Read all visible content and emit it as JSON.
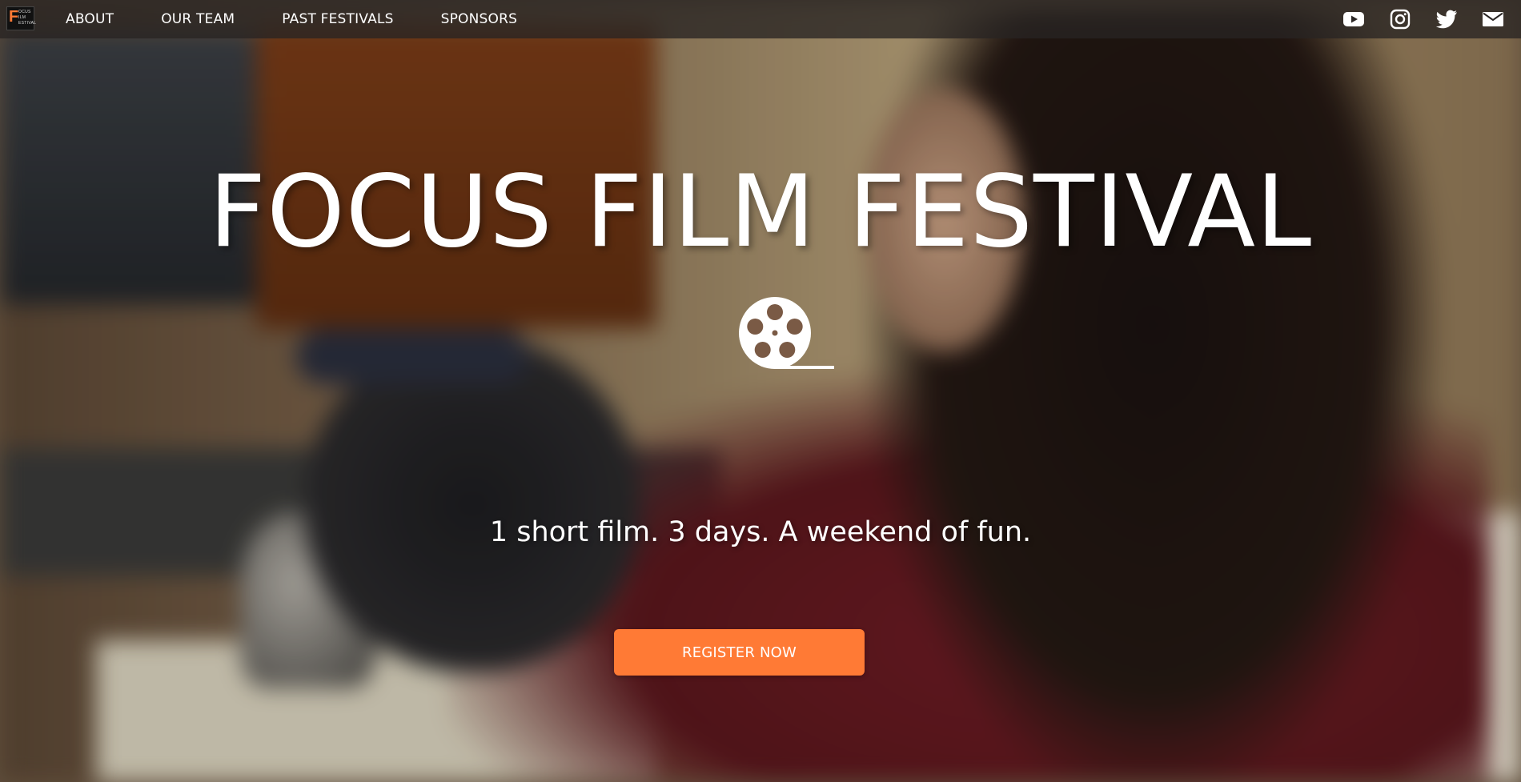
{
  "navbar": {
    "logo": {
      "letter": "F",
      "small_text": [
        "OCUS",
        "ILM",
        "ESTIVAL"
      ]
    },
    "links": [
      "ABOUT",
      "OUR TEAM",
      "PAST FESTIVALS",
      "SPONSORS"
    ],
    "social_icons": [
      "youtube-icon",
      "instagram-icon",
      "twitter-icon",
      "mail-icon"
    ]
  },
  "hero": {
    "title": "FOCUS FILM FESTIVAL",
    "icon": "film-reel-icon",
    "tagline": "1 short film. 3 days. A weekend of fun.",
    "cta_label": "REGISTER NOW"
  },
  "colors": {
    "accent": "#ff7a35",
    "navbar_bg": "#282422",
    "text": "#ffffff"
  }
}
